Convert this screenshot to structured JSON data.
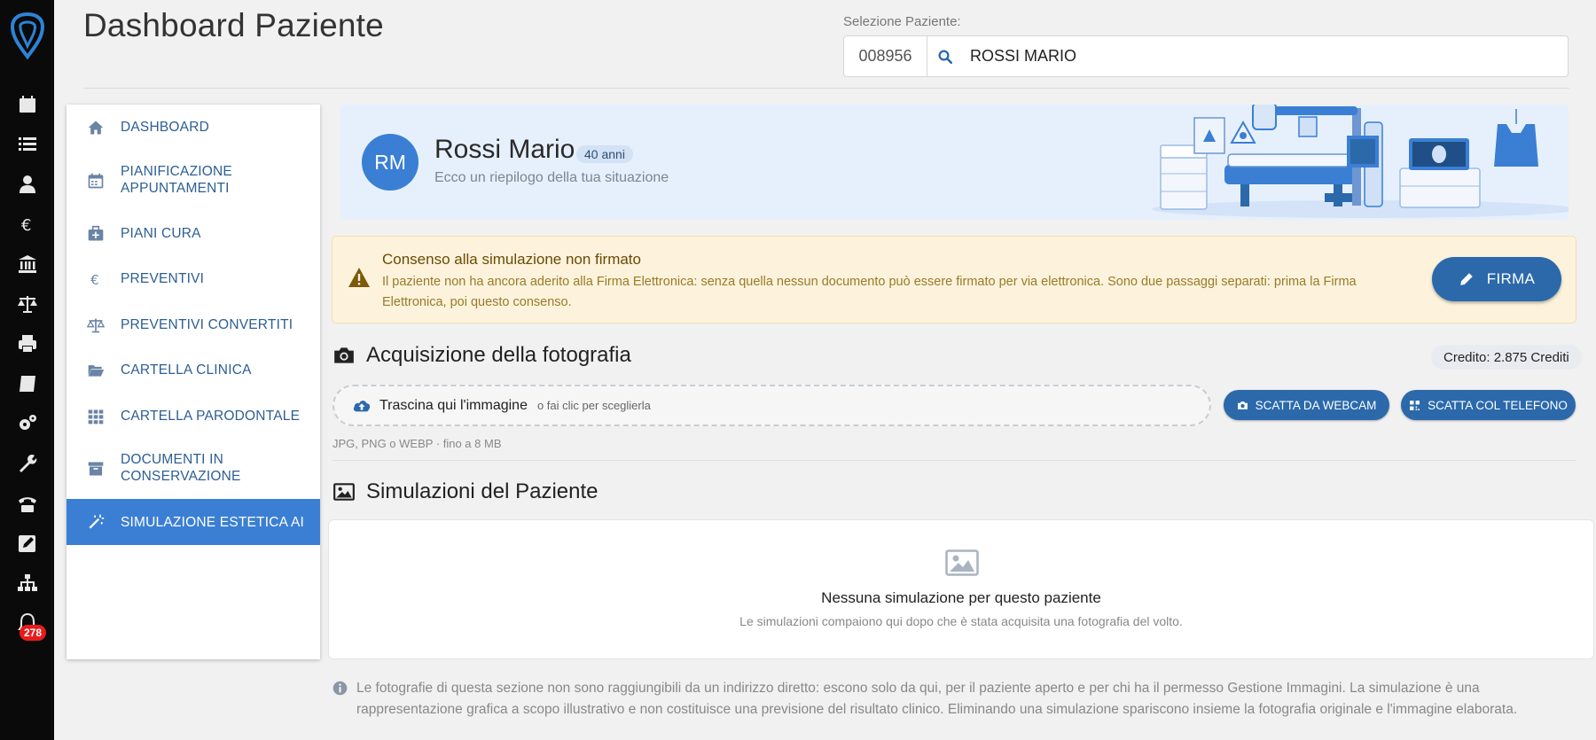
{
  "header": {
    "title": "Dashboard Paziente",
    "selector_label": "Selezione Paziente:",
    "patient_code": "008956",
    "patient_search_value": "ROSSI MARIO"
  },
  "rail": {
    "notification_count": "278",
    "icons": [
      "logo-icon",
      "calendar-icon",
      "list-icon",
      "user-doctor-icon",
      "euro-icon",
      "bank-icon",
      "balance-scale-icon",
      "printer-icon",
      "book-icon",
      "gears-icon",
      "wrench-icon",
      "phone-icon",
      "edit-icon",
      "sitemap-icon",
      "bell-icon"
    ]
  },
  "menu": {
    "items": [
      {
        "label": "DASHBOARD",
        "icon": "home-icon"
      },
      {
        "label": "PIANIFICAZIONE APPUNTAMENTI",
        "icon": "calendar-icon"
      },
      {
        "label": "PIANI CURA",
        "icon": "medkit-icon"
      },
      {
        "label": "PREVENTIVI",
        "icon": "euro-icon"
      },
      {
        "label": "PREVENTIVI CONVERTITI",
        "icon": "balance-scale-icon"
      },
      {
        "label": "CARTELLA CLINICA",
        "icon": "folder-open-icon"
      },
      {
        "label": "CARTELLA PARODONTALE",
        "icon": "grid-icon"
      },
      {
        "label": "DOCUMENTI IN CONSERVAZIONE",
        "icon": "archive-icon"
      },
      {
        "label": "SIMULAZIONE ESTETICA AI",
        "icon": "magic-wand-icon",
        "active": true
      }
    ]
  },
  "patient": {
    "initials": "RM",
    "name": "Rossi Mario",
    "age": "40 anni",
    "subtitle": "Ecco un riepilogo della tua situazione"
  },
  "warning": {
    "title": "Consenso alla simulazione non firmato",
    "text": "Il paziente non ha ancora aderito alla Firma Elettronica: senza quella nessun documento può essere firmato per via elettronica. Sono due passaggi separati: prima la Firma Elettronica, poi questo consenso.",
    "button_label": "FIRMA"
  },
  "photo": {
    "title": "Acquisizione della fotografia",
    "credit": "Credito: 2.875 Crediti",
    "drop_main": "Trascina qui l'immagine",
    "drop_sub": "o fai clic per sceglierla",
    "webcam_button": "SCATTA DA WEBCAM",
    "phone_button": "SCATTA COL TELEFONO",
    "hint": "JPG, PNG o WEBP · fino a 8 MB"
  },
  "simulations": {
    "title": "Simulazioni del Paziente",
    "empty_title": "Nessuna simulazione per questo paziente",
    "empty_sub": "Le simulazioni compaiono qui dopo che è stata acquisita una fotografia del volto."
  },
  "info": {
    "text": "Le fotografie di questa sezione non sono raggiungibili da un indirizzo diretto: escono solo da qui, per il paziente aperto e per chi ha il permesso Gestione Immagini. La simulazione è una rappresentazione grafica a scopo illustrativo e non costituisce una previsione del risultato clinico. Eliminando una simulazione spariscono insieme la fotografia originale e l'immagine elaborata."
  },
  "colors": {
    "primary": "#2b69ab",
    "active_menu": "#3a7fd4",
    "warning_bg": "#fdf3dc",
    "badge": "#e81b1b"
  }
}
